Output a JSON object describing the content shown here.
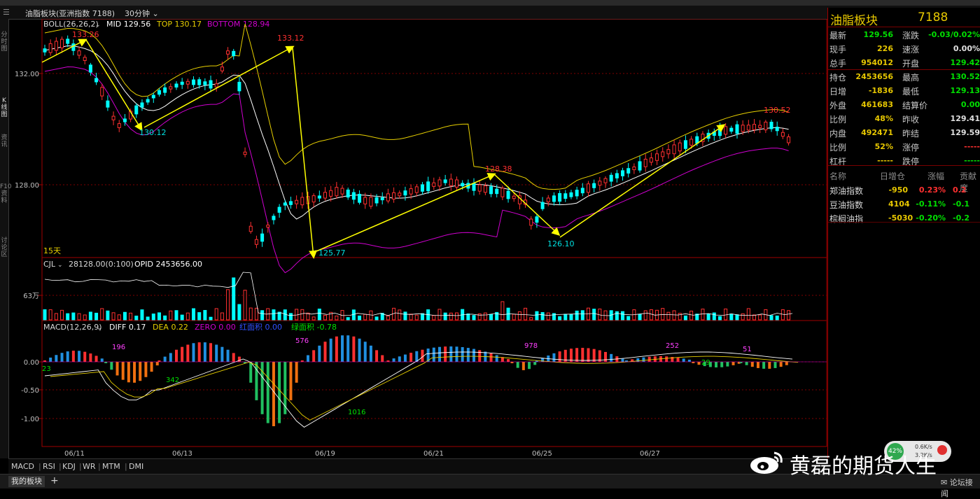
{
  "window": {
    "title": "油脂板块(亚洲指数  7188)",
    "period": "30分钟",
    "left_tabs": [
      "分时图",
      "K线图",
      "资讯",
      "F10资料",
      "讨论区"
    ]
  },
  "main_chart": {
    "indicator_label": "BOLL(26,26,2)",
    "mid": "MID 129.56",
    "top": "TOP 130.17",
    "bottom": "BOTTOM 128.94",
    "y_labels": [
      "132.00",
      "128.00"
    ],
    "annotations": [
      "133.26",
      "130.12",
      "133.12",
      "125.77",
      "128.38",
      "126.10",
      "130.52"
    ],
    "days_label": "15天"
  },
  "volume_chart": {
    "label": "CJL",
    "volume": "28128.00(0:100)",
    "opid": "OPID 2453656.00",
    "y_label": "63万"
  },
  "macd_chart": {
    "label": "MACD(12,26,9)",
    "diff": "DIFF 0.17",
    "dea": "DEA 0.22",
    "zero": "ZERO 0.00",
    "red_area": "红面积 0.00",
    "green_area": "绿面积 -0.78",
    "y_labels": [
      "0.00",
      "-0.50",
      "-1.00"
    ],
    "area_labels": [
      "23",
      "196",
      "342",
      "576",
      "1016",
      "978",
      "252",
      "29",
      "51"
    ]
  },
  "x_axis": [
    "06/11",
    "06/13",
    "06/19",
    "06/21",
    "06/25",
    "06/27"
  ],
  "indicator_tabs": [
    "MACD",
    "RSI",
    "KDJ",
    "WR",
    "MTM",
    "DMI"
  ],
  "bottom_tabs": [
    "我的板块",
    "+"
  ],
  "quote_panel": {
    "name": "油脂板块",
    "code": "7188",
    "rows": [
      {
        "l1": "最新",
        "v1": "129.56",
        "c1": "#00e000",
        "l2": "涨跌",
        "v2": "-0.03/0.02%",
        "c2": "#00e000"
      },
      {
        "l1": "现手",
        "v1": "226",
        "c1": "#e8c800",
        "l2": "速涨",
        "v2": "0.00%",
        "c2": "#e0e0e0"
      },
      {
        "l1": "总手",
        "v1": "954012",
        "c1": "#e8c800",
        "l2": "开盘",
        "v2": "129.42",
        "c2": "#00e000"
      },
      {
        "l1": "持仓",
        "v1": "2453656",
        "c1": "#e8c800",
        "l2": "最高",
        "v2": "130.52",
        "c2": "#00e000"
      },
      {
        "l1": "日增",
        "v1": "-1836",
        "c1": "#e8c800",
        "l2": "最低",
        "v2": "129.13",
        "c2": "#00e000"
      },
      {
        "l1": "外盘",
        "v1": "461683",
        "c1": "#e8c800",
        "l2": "结算价",
        "v2": "0.00",
        "c2": "#00e000"
      },
      {
        "l1": "比例",
        "v1": "48%",
        "c1": "#e8c800",
        "l2": "昨收",
        "v2": "129.41",
        "c2": "#e0e0e0"
      },
      {
        "l1": "内盘",
        "v1": "492471",
        "c1": "#e8c800",
        "l2": "昨结",
        "v2": "129.59",
        "c2": "#e0e0e0"
      },
      {
        "l1": "比例",
        "v1": "52%",
        "c1": "#e8c800",
        "l2": "涨停",
        "v2": "-----",
        "c2": "#ff3030"
      },
      {
        "l1": "杠杆",
        "v1": "-----",
        "c1": "#e8c800",
        "l2": "跌停",
        "v2": "-----",
        "c2": "#00e000"
      }
    ],
    "index_headers": [
      "名称",
      "日增仓",
      "涨幅",
      "贡献度"
    ],
    "index_rows": [
      {
        "name": "郑油指数",
        "inc": "-950",
        "chg": "0.23%",
        "chg_color": "#ff3030",
        "contrib": "0.2",
        "contrib_color": "#ff3030"
      },
      {
        "name": "豆油指数",
        "inc": "4104",
        "chg": "-0.11%",
        "chg_color": "#00e000",
        "contrib": "-0.1",
        "contrib_color": "#00e000"
      },
      {
        "name": "棕榈油指",
        "inc": "-5030",
        "chg": "-0.20%",
        "chg_color": "#00e000",
        "contrib": "-0.2",
        "contrib_color": "#00e000"
      }
    ]
  },
  "status": {
    "cpu": "42%",
    "up": "0.6K/s",
    "down": "3.2K/s",
    "forum": "论坛接闻",
    "watermark": "黄磊的期货人生"
  },
  "colors": {
    "up": "#ff3030",
    "down": "#00ffff",
    "boll_mid": "#ffffff",
    "boll_top": "#e8d000",
    "boll_bottom": "#d000d0",
    "arrow": "#ffff00",
    "grid": "#800000"
  }
}
